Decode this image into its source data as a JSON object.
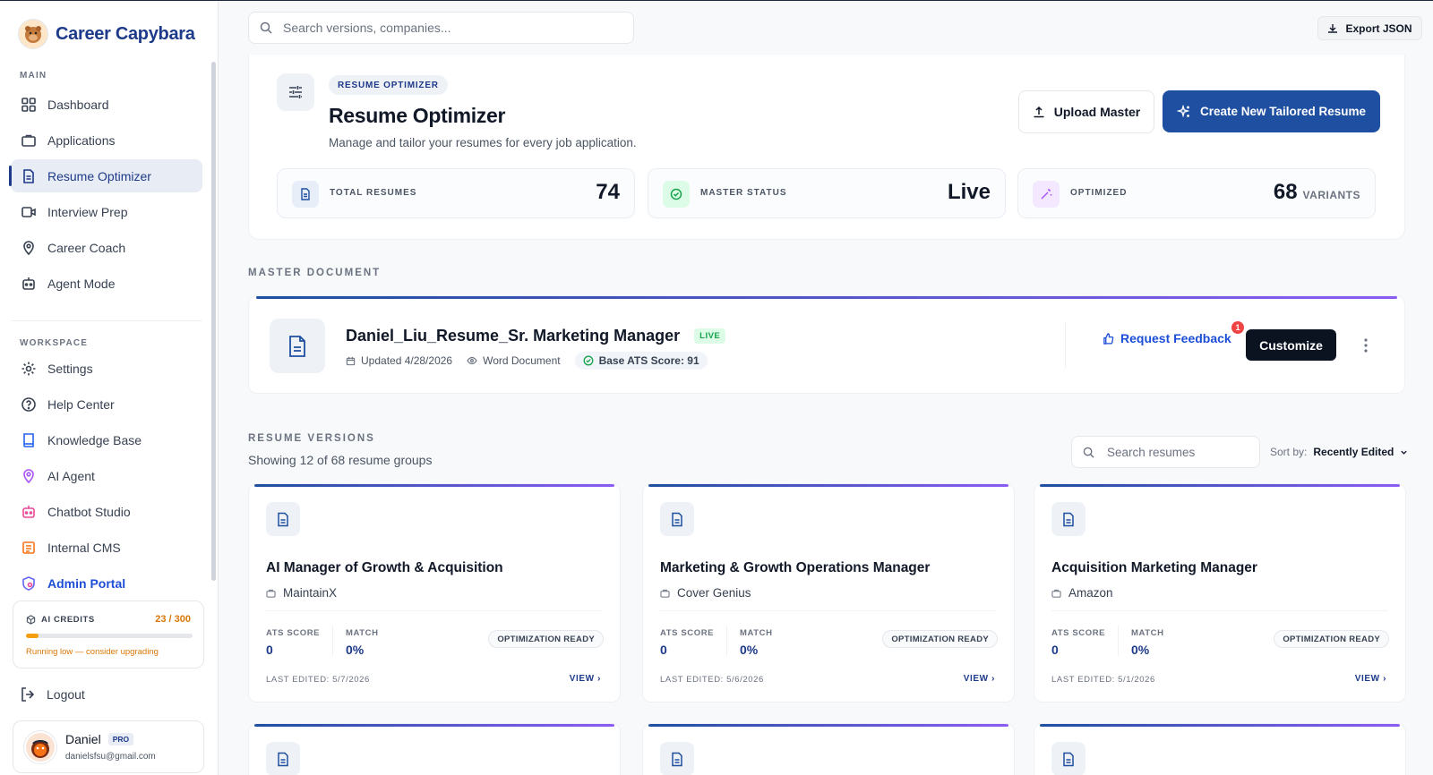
{
  "app": {
    "name": "Career Capybara"
  },
  "sidebar": {
    "main_label": "MAIN",
    "main_items": [
      {
        "label": "Dashboard",
        "icon": "grid-icon"
      },
      {
        "label": "Applications",
        "icon": "briefcase-icon"
      },
      {
        "label": "Resume Optimizer",
        "icon": "document-icon",
        "active": true
      },
      {
        "label": "Interview Prep",
        "icon": "video-icon"
      },
      {
        "label": "Career Coach",
        "icon": "location-pin-icon"
      },
      {
        "label": "Agent Mode",
        "icon": "robot-icon"
      }
    ],
    "workspace_label": "WORKSPACE",
    "workspace_items": [
      {
        "label": "Settings",
        "icon": "gear-icon"
      },
      {
        "label": "Help Center",
        "icon": "help-circle-icon"
      },
      {
        "label": "Knowledge Base",
        "icon": "book-icon"
      },
      {
        "label": "AI Agent",
        "icon": "ai-pin-icon"
      },
      {
        "label": "Chatbot Studio",
        "icon": "chatbot-icon"
      },
      {
        "label": "Internal CMS",
        "icon": "cms-icon"
      },
      {
        "label": "Admin Portal",
        "icon": "shield-icon"
      }
    ],
    "credits": {
      "label": "AI CREDITS",
      "count": "23 / 300",
      "used_fraction": 0.077,
      "warning": "Running low — consider upgrading"
    },
    "logout_label": "Logout",
    "user": {
      "name": "Daniel",
      "badge": "PRO",
      "email": "danielsfsu@gmail.com"
    }
  },
  "topbar": {
    "search_placeholder": "Search versions, companies...",
    "export_label": "Export JSON"
  },
  "header": {
    "pill": "RESUME OPTIMIZER",
    "title": "Resume Optimizer",
    "subtitle": "Manage and tailor your resumes for every job application.",
    "upload_label": "Upload Master",
    "create_label": "Create New Tailored Resume"
  },
  "stats": [
    {
      "label": "TOTAL RESUMES",
      "value": "74",
      "unit": "",
      "icon": "document-icon"
    },
    {
      "label": "MASTER STATUS",
      "value": "Live",
      "unit": "",
      "icon": "check-badge-icon"
    },
    {
      "label": "OPTIMIZED",
      "value": "68",
      "unit": "VARIANTS",
      "icon": "magic-wand-icon"
    }
  ],
  "master": {
    "section_label": "MASTER DOCUMENT",
    "title": "Daniel_Liu_Resume_Sr. Marketing Manager",
    "status": "LIVE",
    "updated": "Updated 4/28/2026",
    "doc_type": "Word Document",
    "ats": "Base ATS Score: 91",
    "feedback_label": "Request Feedback",
    "notif_count": "1",
    "customize_label": "Customize"
  },
  "versions": {
    "section_label": "RESUME VERSIONS",
    "showing": "Showing 12 of 68 resume groups",
    "search_placeholder": "Search resumes",
    "sort_label": "Sort by:",
    "sort_value": "Recently Edited",
    "ats_label": "ATS SCORE",
    "match_label": "MATCH",
    "view_label": "VIEW",
    "cards": [
      {
        "title": "AI Manager of Growth & Acquisition",
        "company": "MaintainX",
        "ats": "0",
        "match": "0%",
        "status": "OPTIMIZATION READY",
        "edited": "LAST EDITED: 5/7/2026"
      },
      {
        "title": "Marketing & Growth Operations Manager",
        "company": "Cover Genius",
        "ats": "0",
        "match": "0%",
        "status": "OPTIMIZATION READY",
        "edited": "LAST EDITED: 5/6/2026"
      },
      {
        "title": "Acquisition Marketing Manager",
        "company": "Amazon",
        "ats": "0",
        "match": "0%",
        "status": "OPTIMIZATION READY",
        "edited": "LAST EDITED: 5/1/2026"
      }
    ]
  }
}
